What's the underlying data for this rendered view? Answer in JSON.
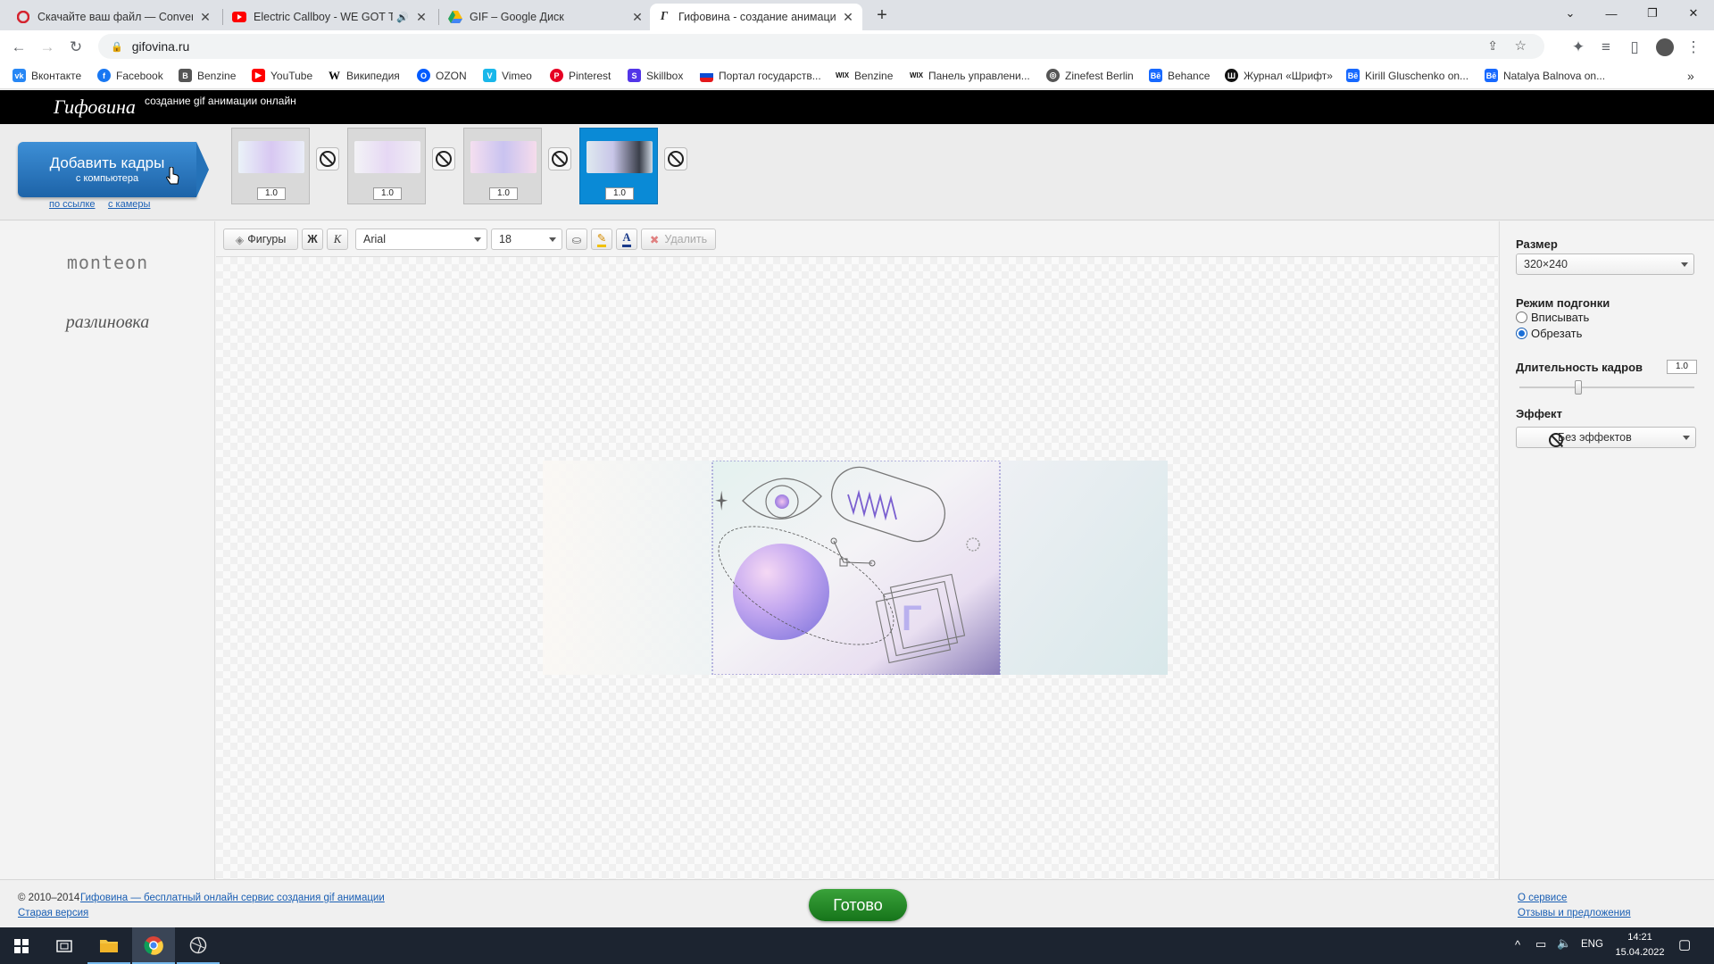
{
  "browser": {
    "tabs": [
      {
        "title": "Скачайте ваш файл — Convertio",
        "icon": "convertio-icon",
        "color": "#d4232f"
      },
      {
        "title": "Electric Callboy - WE GOT THE MOVES",
        "icon": "youtube-icon",
        "color": "#ff0000"
      },
      {
        "title": "GIF – Google Диск",
        "icon": "google-drive-icon",
        "color": "#1fa463"
      },
      {
        "title": "Гифовина - создание анимации",
        "icon": "gifovina-icon",
        "color": "#333333"
      }
    ],
    "url": "gifovina.ru",
    "bookmarks": [
      {
        "label": "Вконтакте",
        "color": "#2787f5"
      },
      {
        "label": "Facebook",
        "color": "#1877f2"
      },
      {
        "label": "Benzine",
        "color": "#444444"
      },
      {
        "label": "YouTube",
        "color": "#ff0000"
      },
      {
        "label": "Википедия",
        "color": "#000000"
      },
      {
        "label": "OZON",
        "color": "#005bff"
      },
      {
        "label": "Vimeo",
        "color": "#19b7ea"
      },
      {
        "label": "Pinterest",
        "color": "#e60023"
      },
      {
        "label": "Skillbox",
        "color": "#5235e8"
      },
      {
        "label": "Портал государств...",
        "color": "#0d4cd3"
      },
      {
        "label": "Benzine",
        "color": "#111111"
      },
      {
        "label": "Панель управлени...",
        "color": "#111111"
      },
      {
        "label": "Zinefest Berlin",
        "color": "#555555"
      },
      {
        "label": "Behance",
        "color": "#1769ff"
      },
      {
        "label": "Журнал «Шрифт»",
        "color": "#111111"
      },
      {
        "label": "Kirill Gluschenko on...",
        "color": "#1769ff"
      },
      {
        "label": "Natalya Balnova on...",
        "color": "#1769ff"
      }
    ]
  },
  "site": {
    "logo": "Гифовина",
    "tagline": "создание gif анимации онлайн"
  },
  "frames_bar": {
    "add_title": "Добавить кадры",
    "add_sub": "с компьютера",
    "link_url": "по ссылке",
    "link_camera": "с камеры",
    "frames": [
      {
        "duration": "1.0",
        "selected": false
      },
      {
        "duration": "1.0",
        "selected": false
      },
      {
        "duration": "1.0",
        "selected": false
      },
      {
        "duration": "1.0",
        "selected": true
      }
    ]
  },
  "left_panel": {
    "fonts": [
      "monteon",
      "разлиновка"
    ]
  },
  "toolbar": {
    "shapes": "Фигуры",
    "bold": "Ж",
    "italic": "К",
    "font": "Arial",
    "size": "18",
    "delete": "Удалить"
  },
  "right_panel": {
    "size_label": "Размер",
    "size_value": "320×240",
    "fit_label": "Режим подгонки",
    "fit_options": [
      "Вписывать",
      "Обрезать"
    ],
    "fit_selected": "Обрезать",
    "duration_label": "Длительность кадров",
    "duration_value": "1.0",
    "effect_label": "Эффект",
    "effect_value": "Без эффектов"
  },
  "footer": {
    "copyright": "© 2010–2014",
    "service_link": "Гифовина — бесплатный онлайн сервис создания gif анимации",
    "old_version": "Старая версия",
    "done": "Готово",
    "about": "О сервисе",
    "feedback": "Отзывы и предложения"
  },
  "taskbar": {
    "lang": "ENG",
    "time": "14:21",
    "date": "15.04.2022"
  }
}
